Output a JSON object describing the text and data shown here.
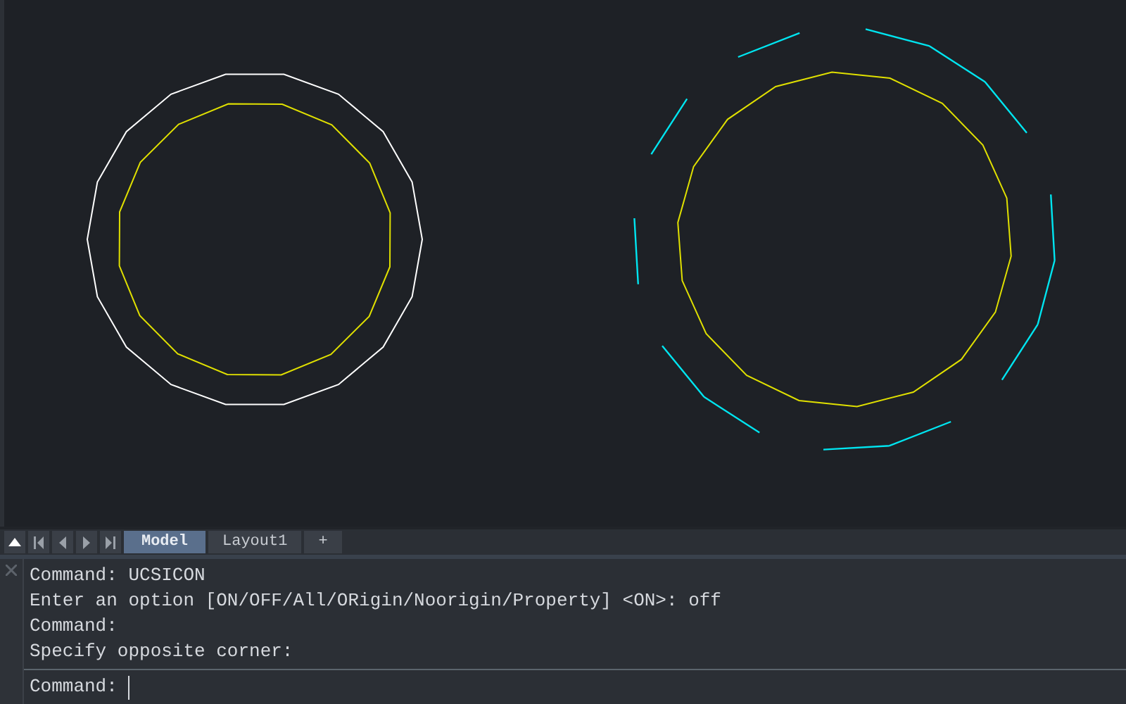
{
  "layout_tabs": [
    {
      "label": "Model",
      "selected": true
    },
    {
      "label": "Layout1",
      "selected": false
    },
    {
      "label": "+",
      "selected": false
    }
  ],
  "command_history": [
    "Command: UCSICON",
    "Enter an option [ON/OFF/All/ORigin/Noorigin/Property] <ON>: off",
    "Command:",
    "Specify opposite corner:"
  ],
  "command_line": {
    "prompt": "Command:"
  }
}
